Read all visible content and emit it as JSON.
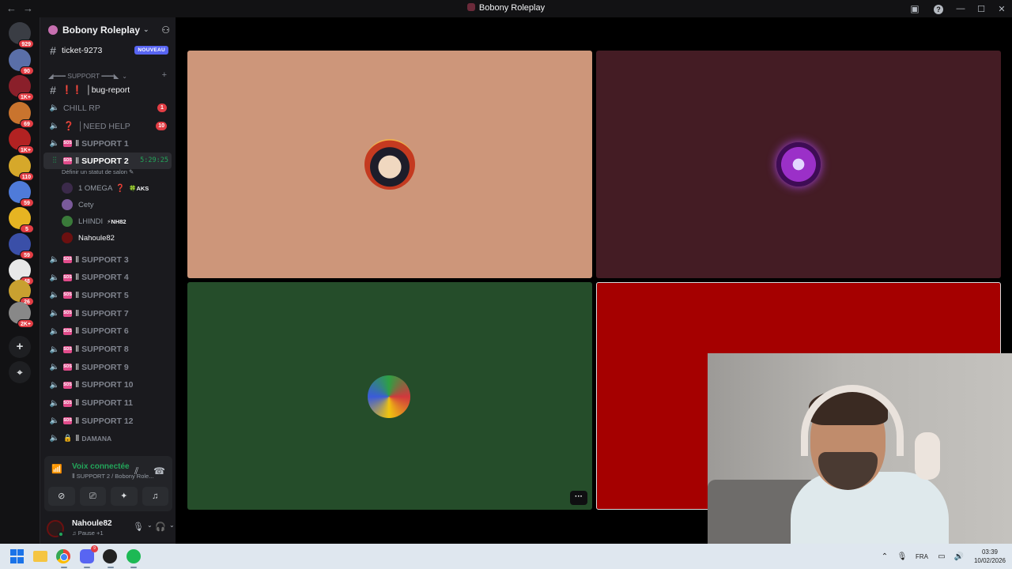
{
  "window": {
    "title": "Bobony Roleplay",
    "nav_back": "←",
    "nav_forward": "→",
    "controls": {
      "minimize": "—",
      "maximize": "☐",
      "close": "✕"
    }
  },
  "rail": {
    "servers": [
      {
        "name": "dm-home",
        "badge": "929",
        "color": "#3a3d44"
      },
      {
        "name": "server-2",
        "badge": "90",
        "color": "#5a6fa8"
      },
      {
        "name": "server-3",
        "badge": "1K+",
        "color": "#8a1f2a"
      },
      {
        "name": "server-4",
        "badge": "69",
        "color": "#c9742e"
      },
      {
        "name": "server-5",
        "badge": "1K+",
        "color": "#b22222"
      },
      {
        "name": "server-6",
        "badge": "110",
        "color": "#d6a82a"
      },
      {
        "name": "server-7",
        "badge": "59",
        "color": "#4f7bd9"
      },
      {
        "name": "server-8",
        "badge": "5",
        "color": "#e6b422"
      },
      {
        "name": "server-9",
        "badge": "59",
        "color": "#3a4fa8"
      },
      {
        "name": "server-10",
        "badge": "48",
        "color": "#e8e8e8"
      },
      {
        "name": "server-11",
        "badge": "26",
        "color": "#c8a030"
      },
      {
        "name": "server-12",
        "badge": "2K+",
        "color": "#888888"
      }
    ],
    "add_server": "+",
    "discover": "⌖"
  },
  "server": {
    "name": "Bobony Roleplay",
    "caret": "⌄"
  },
  "channels": {
    "ticket": {
      "name": "ticket-9273",
      "tag": "NOUVEAU"
    },
    "category": "◢━━━ SUPPORT ━━━◣",
    "bug_report": {
      "prefix": "❗❗",
      "name": "│bug-report"
    },
    "chill": {
      "name": "CHILL RP",
      "count": "1"
    },
    "need_help": {
      "prefix": "❓",
      "name": "│NEED HELP",
      "count": "10"
    },
    "support1": "SUPPORT 1",
    "support2": {
      "name": "SUPPORT 2",
      "timer": "5:29:25",
      "status": "Définir un statut de salon ✎"
    },
    "voice_users": [
      {
        "name": "1 ОМЕGА",
        "mark": "❓",
        "tag": "🍀AKS",
        "color": "#3b2a4a"
      },
      {
        "name": "Cety",
        "mark": "",
        "tag": "",
        "color": "#7a5a9a"
      },
      {
        "name": "LHINDI",
        "mark": "",
        "tag": "⚡NH82",
        "color": "#3a7a3a"
      },
      {
        "name": "Nahoule82",
        "mark": "",
        "tag": "",
        "color": "#6b1010"
      }
    ],
    "supports": [
      "SUPPORT 3",
      "SUPPORT 4",
      "SUPPORT 5",
      "SUPPORT 7",
      "SUPPORT 6",
      "SUPPORT 8",
      "SUPPORT 9",
      "SUPPORT 10",
      "SUPPORT 11",
      "SUPPORT 12"
    ],
    "damana": "DAMANA",
    "emoji_label": "SOS",
    "bar": "Ⅱ"
  },
  "voice": {
    "status": "Voix connectée",
    "location": "Ⅱ SUPPORT 2 / Bobony Role...",
    "buttons": {
      "camera": "⊘",
      "screen": "⎚",
      "activity": "✦",
      "soundboard": "♫"
    }
  },
  "user": {
    "name": "Nahoule82",
    "status": "♫ Pause +1",
    "mic": "🎙",
    "headset": "🎧",
    "settings": "⚙"
  },
  "stage": {
    "tiles": [
      {
        "name": "tile-omega",
        "color": "#cd967a"
      },
      {
        "name": "tile-cety",
        "color": "#441c24"
      },
      {
        "name": "tile-lhindi",
        "color": "#254d2a"
      },
      {
        "name": "tile-nahoule",
        "color": "#a50000"
      }
    ],
    "more": "···"
  },
  "taskbar": {
    "lang": "FRA",
    "time": "03:39",
    "date": "10/02/2026",
    "discord_badge": "9"
  }
}
